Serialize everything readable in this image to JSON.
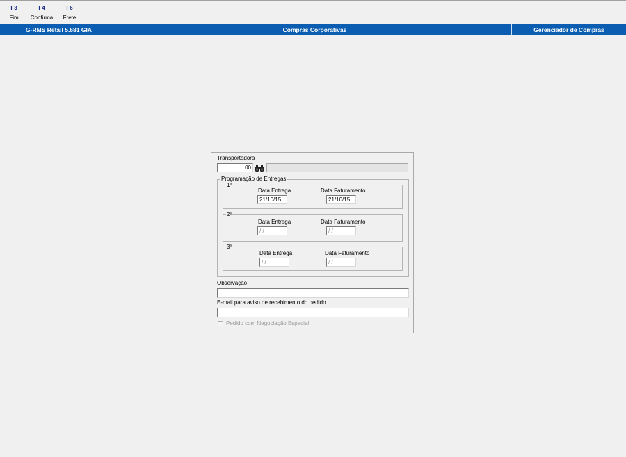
{
  "toolbar": {
    "keys": [
      {
        "key": "F3",
        "label": "Fim"
      },
      {
        "key": "F4",
        "label": "Confirma"
      },
      {
        "key": "F6",
        "label": "Frete"
      }
    ]
  },
  "titlebar": {
    "left": "G-RMS Retail 5.681 GIA",
    "center": "Compras Corporativas",
    "right": "Gerenciador de Compras"
  },
  "form": {
    "transportadora_label": "Transportadora",
    "transportadora_code": "00",
    "transportadora_name": "",
    "programacao_label": "Programação de Entregas",
    "entregas": [
      {
        "ordinal": "1º",
        "entrega_label": "Data Entrega",
        "faturamento_label": "Data Faturamento",
        "entrega_value": "21/10/15",
        "faturamento_value": "21/10/15"
      },
      {
        "ordinal": "2º",
        "entrega_label": "Data Entrega",
        "faturamento_label": "Data Faturamento",
        "entrega_value": " /  /",
        "faturamento_value": " /  /"
      },
      {
        "ordinal": "3º",
        "entrega_label": "Data Entrega",
        "faturamento_label": "Data Faturamento",
        "entrega_value": " /  /",
        "faturamento_value": " /  /"
      }
    ],
    "observacao_label": "Observação",
    "observacao_value": "",
    "email_label": "E-mail para aviso de recebimento do pedido",
    "email_value": "",
    "negociacao_label": "Pedido com Negociação Especial",
    "negociacao_checked": false
  },
  "colors": {
    "titlebar_bg": "#0a5db0",
    "fkey_color": "#1a2a8a",
    "window_bg": "#f0f0f0"
  },
  "icons": [
    "binoculars-icon"
  ]
}
